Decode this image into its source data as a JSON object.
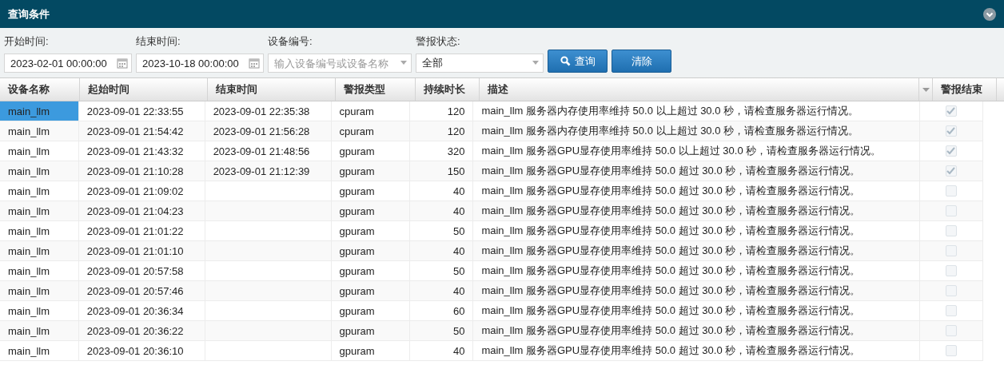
{
  "panel": {
    "title": "查询条件",
    "expanded": true
  },
  "filters": [
    {
      "kind": "date",
      "label": "开始时间:",
      "value": "2023-02-01 00:00:00"
    },
    {
      "kind": "date",
      "label": "结束时间:",
      "value": "2023-10-18 00:00:00"
    },
    {
      "kind": "combo",
      "label": "设备编号:",
      "placeholder": "输入设备编号或设备名称"
    },
    {
      "kind": "select",
      "label": "警报状态:",
      "value": "全部"
    }
  ],
  "buttons": [
    {
      "kind": "search",
      "label": "查询"
    },
    {
      "kind": "plain",
      "label": "清除"
    }
  ],
  "table": {
    "columns": [
      "设备名称",
      "起始时间",
      "结束时间",
      "警报类型",
      "持续时长",
      "描述",
      "警报结束"
    ],
    "rows": [
      {
        "selected": true,
        "device": "main_llm",
        "start": "2023-09-01 22:33:55",
        "end": "2023-09-01 22:35:38",
        "type": "cpuram",
        "duration": "120",
        "description": "main_llm 服务器内存使用率维持 50.0 以上超过 30.0 秒，请检查服务器运行情况。",
        "ended": true
      },
      {
        "selected": false,
        "device": "main_llm",
        "start": "2023-09-01 21:54:42",
        "end": "2023-09-01 21:56:28",
        "type": "cpuram",
        "duration": "120",
        "description": "main_llm 服务器内存使用率维持 50.0 以上超过 30.0 秒，请检查服务器运行情况。",
        "ended": true
      },
      {
        "selected": false,
        "device": "main_llm",
        "start": "2023-09-01 21:43:32",
        "end": "2023-09-01 21:48:56",
        "type": "gpuram",
        "duration": "320",
        "description": "main_llm 服务器GPU显存使用率维持 50.0 以上超过 30.0 秒，请检查服务器运行情况。",
        "ended": true
      },
      {
        "selected": false,
        "device": "main_llm",
        "start": "2023-09-01 21:10:28",
        "end": "2023-09-01 21:12:39",
        "type": "gpuram",
        "duration": "150",
        "description": "main_llm 服务器GPU显存使用率维持 50.0 超过 30.0 秒，请检查服务器运行情况。",
        "ended": true
      },
      {
        "selected": false,
        "device": "main_llm",
        "start": "2023-09-01 21:09:02",
        "end": "",
        "type": "gpuram",
        "duration": "40",
        "description": "main_llm 服务器GPU显存使用率维持 50.0 超过 30.0 秒，请检查服务器运行情况。",
        "ended": false
      },
      {
        "selected": false,
        "device": "main_llm",
        "start": "2023-09-01 21:04:23",
        "end": "",
        "type": "gpuram",
        "duration": "40",
        "description": "main_llm 服务器GPU显存使用率维持 50.0 超过 30.0 秒，请检查服务器运行情况。",
        "ended": false
      },
      {
        "selected": false,
        "device": "main_llm",
        "start": "2023-09-01 21:01:22",
        "end": "",
        "type": "gpuram",
        "duration": "50",
        "description": "main_llm 服务器GPU显存使用率维持 50.0 超过 30.0 秒，请检查服务器运行情况。",
        "ended": false
      },
      {
        "selected": false,
        "device": "main_llm",
        "start": "2023-09-01 21:01:10",
        "end": "",
        "type": "gpuram",
        "duration": "40",
        "description": "main_llm 服务器GPU显存使用率维持 50.0 超过 30.0 秒，请检查服务器运行情况。",
        "ended": false
      },
      {
        "selected": false,
        "device": "main_llm",
        "start": "2023-09-01 20:57:58",
        "end": "",
        "type": "gpuram",
        "duration": "50",
        "description": "main_llm 服务器GPU显存使用率维持 50.0 超过 30.0 秒，请检查服务器运行情况。",
        "ended": false
      },
      {
        "selected": false,
        "device": "main_llm",
        "start": "2023-09-01 20:57:46",
        "end": "",
        "type": "gpuram",
        "duration": "40",
        "description": "main_llm 服务器GPU显存使用率维持 50.0 超过 30.0 秒，请检查服务器运行情况。",
        "ended": false
      },
      {
        "selected": false,
        "device": "main_llm",
        "start": "2023-09-01 20:36:34",
        "end": "",
        "type": "gpuram",
        "duration": "60",
        "description": "main_llm 服务器GPU显存使用率维持 50.0 超过 30.0 秒，请检查服务器运行情况。",
        "ended": false
      },
      {
        "selected": false,
        "device": "main_llm",
        "start": "2023-09-01 20:36:22",
        "end": "",
        "type": "gpuram",
        "duration": "50",
        "description": "main_llm 服务器GPU显存使用率维持 50.0 超过 30.0 秒，请检查服务器运行情况。",
        "ended": false
      },
      {
        "selected": false,
        "device": "main_llm",
        "start": "2023-09-01 20:36:10",
        "end": "",
        "type": "gpuram",
        "duration": "40",
        "description": "main_llm 服务器GPU显存使用率维持 50.0 超过 30.0 秒，请检查服务器运行情况。",
        "ended": false
      }
    ]
  }
}
